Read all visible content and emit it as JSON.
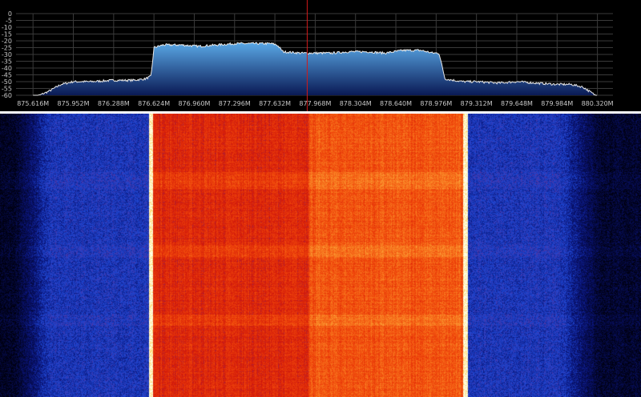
{
  "y_axis": {
    "labels": [
      "0",
      "-5",
      "-10",
      "-15",
      "-20",
      "-25",
      "-30",
      "-35",
      "-40",
      "-45",
      "-50",
      "-55",
      "-60"
    ],
    "min_db": -60,
    "max_db": 0
  },
  "x_axis": {
    "labels": [
      "875.616M",
      "875.952M",
      "876.288M",
      "876.624M",
      "876.960M",
      "877.296M",
      "877.632M",
      "877.968M",
      "878.304M",
      "878.640M",
      "878.976M",
      "879.312M",
      "879.648M",
      "879.984M",
      "880.320M"
    ],
    "start_mhz": 875.616,
    "end_mhz": 880.32
  },
  "tuned_frequency_mhz": 877.968,
  "colors": {
    "background": "#000000",
    "grid": "#3a3a3a",
    "trace": "#e8e8e8",
    "fill_top": "#5aa8e6",
    "fill_bottom": "#0a1a55",
    "cursor": "#d11a1a",
    "divider": "#ffffff"
  },
  "chart_data": {
    "type": "area",
    "xlabel": "",
    "ylabel": "",
    "xlim": [
      875.616,
      880.32
    ],
    "ylim": [
      -60,
      0
    ],
    "grid": true,
    "x": [
      875.616,
      875.75,
      875.85,
      875.952,
      876.1,
      876.288,
      876.45,
      876.55,
      876.6,
      876.624,
      876.7,
      876.85,
      877.0,
      877.15,
      877.3,
      877.45,
      877.6,
      877.65,
      877.7,
      877.85,
      877.968,
      878.1,
      878.25,
      878.4,
      878.55,
      878.7,
      878.85,
      878.95,
      879.0,
      879.05,
      879.2,
      879.312,
      879.5,
      879.648,
      879.8,
      879.984,
      880.1,
      880.2,
      880.32
    ],
    "y": [
      -62,
      -57,
      -52,
      -50,
      -50,
      -49,
      -49,
      -48,
      -46,
      -25,
      -23,
      -23,
      -24,
      -23,
      -22,
      -22,
      -22,
      -23,
      -28,
      -29,
      -29,
      -29,
      -28,
      -28,
      -29,
      -27,
      -27,
      -29,
      -29,
      -48,
      -50,
      -50,
      -51,
      -50,
      -51,
      -52,
      -52,
      -54,
      -61
    ]
  }
}
